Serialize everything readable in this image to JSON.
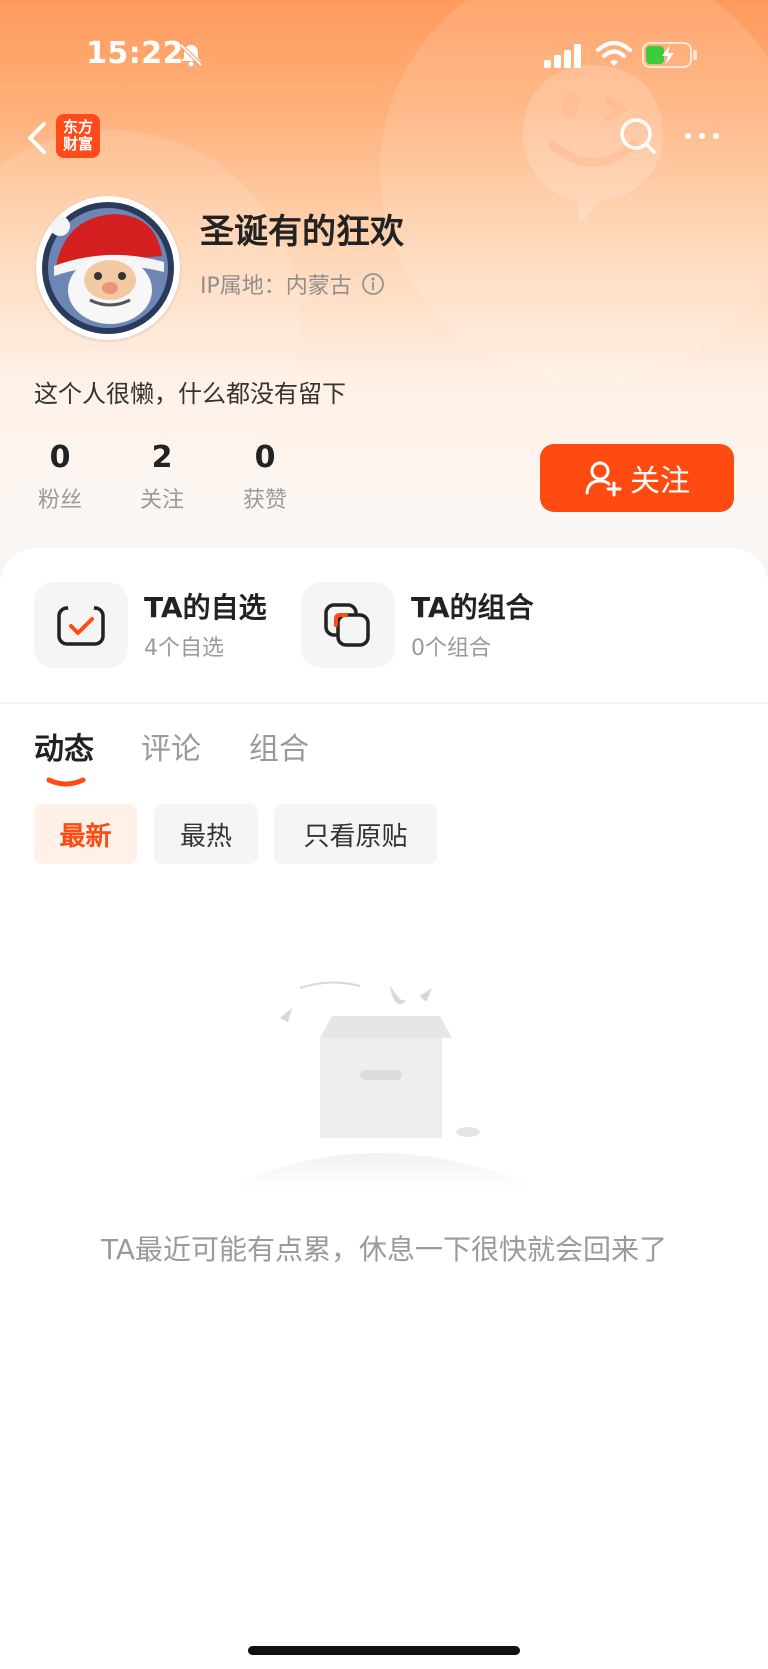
{
  "status_bar": {
    "time": "15:22"
  },
  "header": {
    "logo_line1": "东方",
    "logo_line2": "财富"
  },
  "profile": {
    "name": "圣诞有的狂欢",
    "ip_label": "IP属地：",
    "ip_value": "内蒙古",
    "bio": "这个人很懒，什么都没有留下"
  },
  "stats": [
    {
      "value": "0",
      "label": "粉丝"
    },
    {
      "value": "2",
      "label": "关注"
    },
    {
      "value": "0",
      "label": "获赞"
    }
  ],
  "follow_button": {
    "label": "关注"
  },
  "features": [
    {
      "title": "TA的自选",
      "subtitle": "4个自选"
    },
    {
      "title": "TA的组合",
      "subtitle": "0个组合"
    }
  ],
  "tabs": [
    {
      "label": "动态",
      "active": true
    },
    {
      "label": "评论",
      "active": false
    },
    {
      "label": "组合",
      "active": false
    }
  ],
  "filters": [
    {
      "label": "最新",
      "active": true
    },
    {
      "label": "最热",
      "active": false
    },
    {
      "label": "只看原贴",
      "active": false
    }
  ],
  "empty_state": {
    "message": "TA最近可能有点累，休息一下很快就会回来了"
  },
  "colors": {
    "accent": "#ff4a12",
    "muted": "#9a9a9a"
  }
}
